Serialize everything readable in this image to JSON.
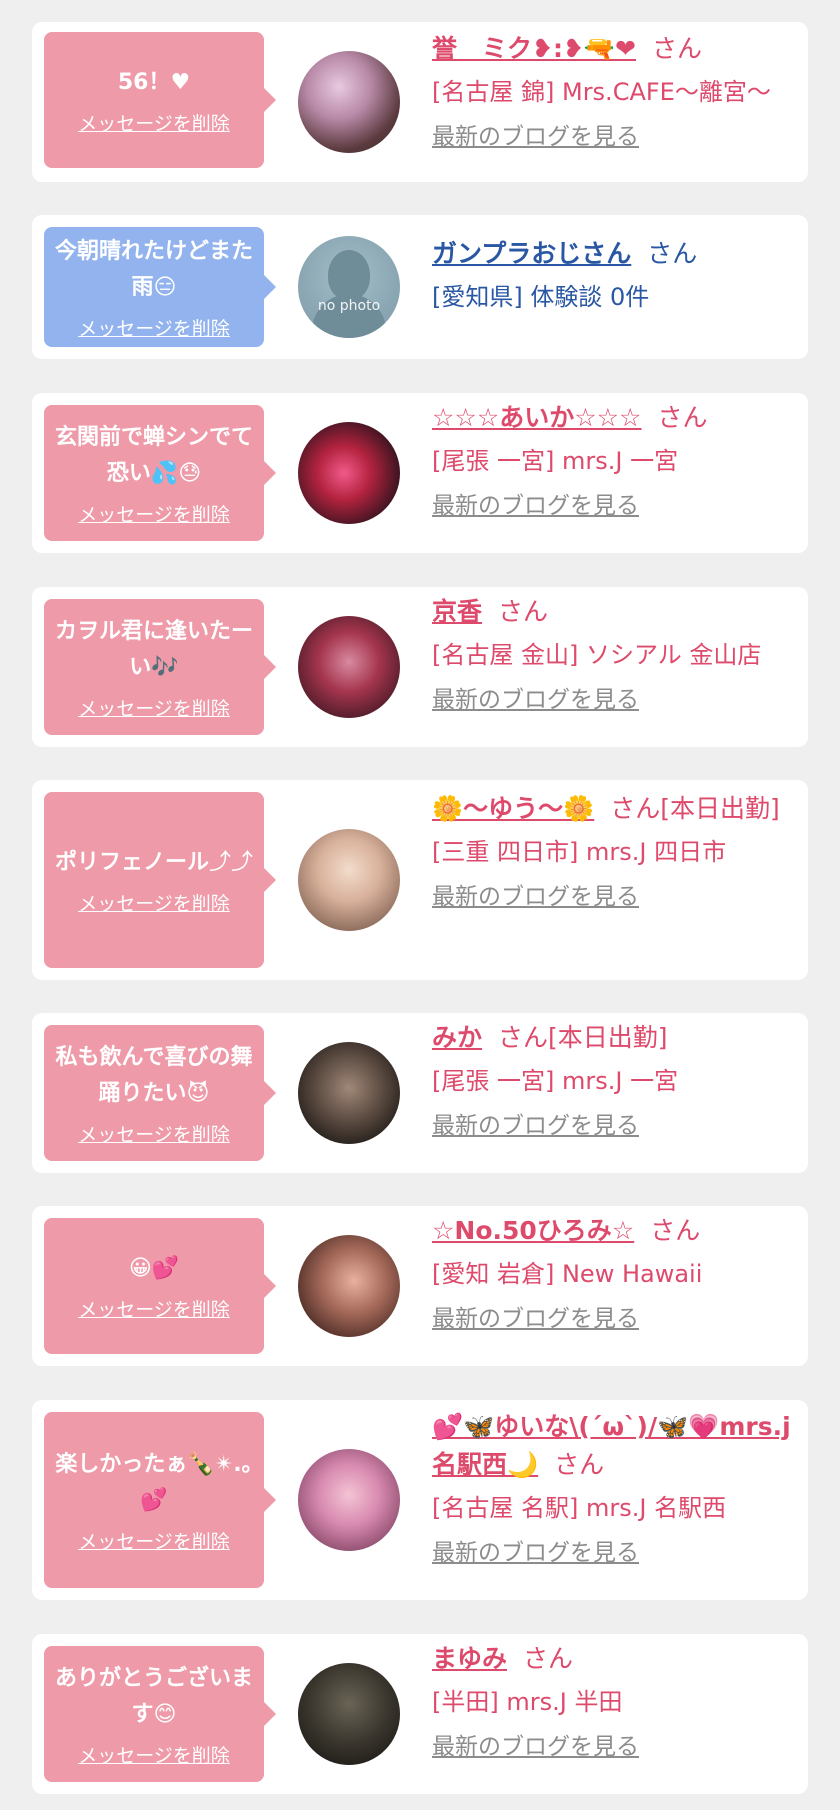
{
  "delete_label": "メッセージを削除",
  "blog_label": "最新のブログを見る",
  "colors": {
    "pink_bubble": "#ee9aa8",
    "blue_bubble": "#92b3ee",
    "name_pink": "#dd4a6b",
    "name_blue": "#2a57a3",
    "link_gray": "#8c8c8c"
  },
  "messages": [
    {
      "message": "56！",
      "emoji": "♥",
      "name": "誉　ミク❥:❥🔫❤",
      "suffix": "さん",
      "shop": "[名古屋 錦] Mrs.CAFE～離宮～",
      "show_blog": true,
      "bubble_color": "pink",
      "avatar_bg": "radial-gradient(circle at 40% 35%, #e8c9e0 0%, #b88aa8 35%, #5b3a3e 70%, #3a2a28 100%)"
    },
    {
      "message": "今朝晴れたけどまた雨",
      "emoji": "😑",
      "name": "ガンプラおじさん",
      "suffix": "さん",
      "shop": "[愛知県] 体験談 0件",
      "show_blog": false,
      "bubble_color": "blue",
      "avatar_text": "no photo"
    },
    {
      "message": "玄関前で蝉シンでて恐い",
      "emoji": "💦😓",
      "name": "☆☆☆あいか☆☆☆",
      "suffix": "さん",
      "shop": "[尾張 一宮] mrs.J 一宮",
      "show_blog": true,
      "bubble_color": "pink",
      "avatar_bg": "radial-gradient(circle at 45% 50%, #f05a8a 0%, #b4233f 35%, #3a1420 75%, #1a0c10 100%)"
    },
    {
      "message": "カヲル君に逢いたーい",
      "emoji": "🎶",
      "name": "京香",
      "suffix": "さん",
      "shop": "[名古屋 金山] ソシアル 金山店",
      "show_blog": true,
      "bubble_color": "pink",
      "avatar_bg": "radial-gradient(circle at 50% 45%, #d88aa0 0%, #a4354e 40%, #4a1a26 80%, #241015 100%)"
    },
    {
      "message": "ポリフェノール",
      "emoji": "⤴⤴",
      "name": "🌼～ゆう～🌼",
      "suffix": "さん[本日出勤]",
      "shop": "[三重 四日市] mrs.J 四日市",
      "show_blog": true,
      "bubble_color": "pink",
      "avatar_bg": "radial-gradient(circle at 50% 40%, #f3dccb 0%, #d7b09a 40%, #8a6a5a 80%, #5a443a 100%)"
    },
    {
      "message": "私も飲んで喜びの舞踊りたい",
      "emoji": "😈",
      "name": "みか",
      "suffix": "さん[本日出勤]",
      "shop": "[尾張 一宮] mrs.J 一宮",
      "show_blog": true,
      "bubble_color": "pink",
      "avatar_bg": "radial-gradient(circle at 50% 45%, #a08878 0%, #5a4a40 45%, #1a1614 85%, #0c0a0a 100%)"
    },
    {
      "message": "",
      "emoji": "😀💕",
      "name": "☆No.50ひろみ☆",
      "suffix": "さん",
      "shop": "[愛知 岩倉] New Hawaii",
      "show_blog": true,
      "bubble_color": "pink",
      "avatar_bg": "radial-gradient(circle at 55% 45%, #e8b0a0 0%, #a66a5a 40%, #4a2a24 80%, #2a1814 100%)"
    },
    {
      "message": "楽しかったぁ🍾✴.｡",
      "emoji": "💕",
      "name": "💕🦋ゆいな\\(´ω`)/🦋💗mrs.j名駅西🌙",
      "suffix": "さん",
      "shop": "[名古屋 名駅] mrs.J 名駅西",
      "show_blog": true,
      "bubble_color": "pink",
      "avatar_bg": "radial-gradient(circle at 50% 45%, #f4c4d4 0%, #d88ab0 40%, #8a4a6a 80%, #5a2a44 100%)"
    },
    {
      "message": "ありがとうございます",
      "emoji": "😊",
      "name": "まゆみ",
      "suffix": "さん",
      "shop": "[半田] mrs.J 半田",
      "show_blog": true,
      "bubble_color": "pink",
      "avatar_bg": "radial-gradient(circle at 50% 40%, #6a6456 0%, #3a362e 50%, #1a1814 90%, #0c0c0a 100%)"
    }
  ]
}
